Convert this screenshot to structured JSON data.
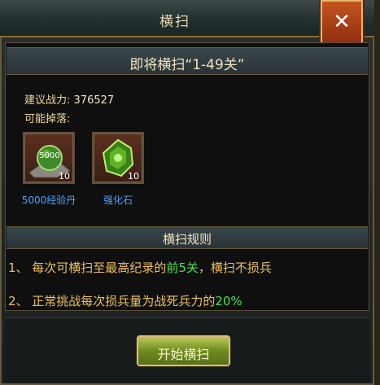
{
  "dialog": {
    "title": "横扫",
    "close_label": "✕",
    "subtitle": "即将横扫“1-49关”"
  },
  "info": {
    "power_label": "建议战力:",
    "power_value": "376527",
    "drops_label": "可能掉落:"
  },
  "drops": [
    {
      "name": "5000经验丹",
      "qty": "10",
      "icon_text": "5000",
      "icon": "exp-pill-icon"
    },
    {
      "name": "强化石",
      "qty": "10",
      "icon": "enhance-stone-icon"
    }
  ],
  "rules": {
    "header": "横扫规则",
    "rule1_prefix": "1、 每次可横扫至最高纪录的",
    "rule1_highlight": "前5关",
    "rule1_suffix": "，横扫不损兵",
    "rule2_prefix": "2、 正常挑战每次损兵量为战死兵力的",
    "rule2_highlight": "20%"
  },
  "actions": {
    "start_label": "开始横扫"
  },
  "colors": {
    "highlight_green": "#4ee04e",
    "rule_text": "#efc15e",
    "item_name": "#4aa6ff"
  }
}
